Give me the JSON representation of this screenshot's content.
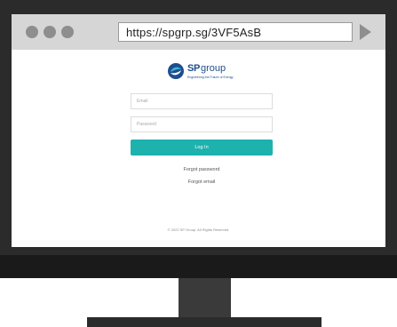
{
  "browser": {
    "url": "https://spgrp.sg/3VF5AsB"
  },
  "brand": {
    "name_sp": "SP",
    "name_group": "group",
    "tagline": "Engineering the Future of Energy",
    "color": "#1f4e8c"
  },
  "login": {
    "email_placeholder": "Email",
    "password_placeholder": "Password",
    "login_label": "Log In",
    "forgot_password": "Forgot password",
    "forgot_email": "Forgot email",
    "button_color": "#1db2ae"
  },
  "footer": {
    "copyright": "© 2022 SP Group. All Rights Reserved."
  },
  "icons": [
    "browser-dot-icon",
    "go-arrow-icon",
    "sp-logo-icon"
  ]
}
